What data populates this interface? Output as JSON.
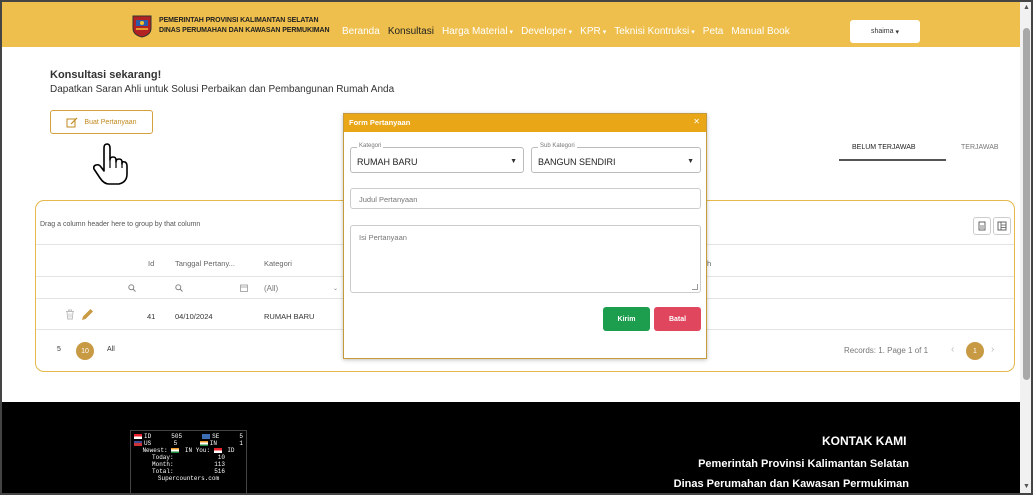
{
  "navbar": {
    "org_line1": "PEMERINTAH PROVINSI KALIMANTAN SELATAN",
    "org_line2": "DINAS PERUMAHAN DAN KAWASAN PERMUKIMAN",
    "menu": [
      {
        "label": "Beranda"
      },
      {
        "label": "Konsultasi"
      },
      {
        "label": "Harga Material"
      },
      {
        "label": "Developer"
      },
      {
        "label": "KPR"
      },
      {
        "label": "Teknisi Kontruksi"
      },
      {
        "label": "Peta"
      },
      {
        "label": "Manual Book"
      }
    ],
    "user": "shaima",
    "color": "#eebf4c"
  },
  "intro": {
    "title": "Konsultasi sekarang!",
    "subtitle": "Dapatkan Saran Ahli untuk Solusi Perbaikan dan Pembangunan Rumah Anda",
    "ask_button": "Buat Pertanyaan"
  },
  "tabs": {
    "unanswered": "BELUM TERJAWAB",
    "answered": "TERJAWAB"
  },
  "grid": {
    "group_hint": "Drag a column header here to group by that column",
    "columns": {
      "id": "Id",
      "date": "Tanggal Pertany...",
      "category": "Kategori",
      "trailing": "h"
    },
    "filter_all": "(All)",
    "row": {
      "id": "41",
      "date": "04/10/2024",
      "category": "RUMAH BARU"
    },
    "page_sizes": [
      "5",
      "10",
      "All"
    ],
    "records": "Records: 1. Page 1 of 1",
    "current_page": "1"
  },
  "modal": {
    "title": "Form Pertanyaan",
    "category_label": "Kategori",
    "category_value": "RUMAH BARU",
    "subcategory_label": "Sub Kategori",
    "subcategory_value": "BANGUN SENDIRI",
    "title_placeholder": "Judul Pertanyaan",
    "body_placeholder": "Isi Pertanyaan",
    "send": "Kirim",
    "cancel": "Batal"
  },
  "footer": {
    "counter": {
      "rows": [
        {
          "c1": "ID",
          "v1": "505",
          "c2": "SE",
          "v2": "5"
        },
        {
          "c1": "US",
          "v1": "5",
          "c2": "IN",
          "v2": "1"
        }
      ],
      "newest_label": "Newest:",
      "inyou_label": "IN You:",
      "you_code": "ID",
      "today_label": "Today:",
      "today": "10",
      "month_label": "Month:",
      "month": "113",
      "total_label": "Total:",
      "total": "516",
      "brand": "Supercounters.com"
    },
    "contact_title": "KONTAK KAMI",
    "contact_line1": "Pemerintah Provinsi Kalimantan Selatan",
    "contact_line2": "Dinas Perumahan dan Kawasan Permukiman"
  }
}
